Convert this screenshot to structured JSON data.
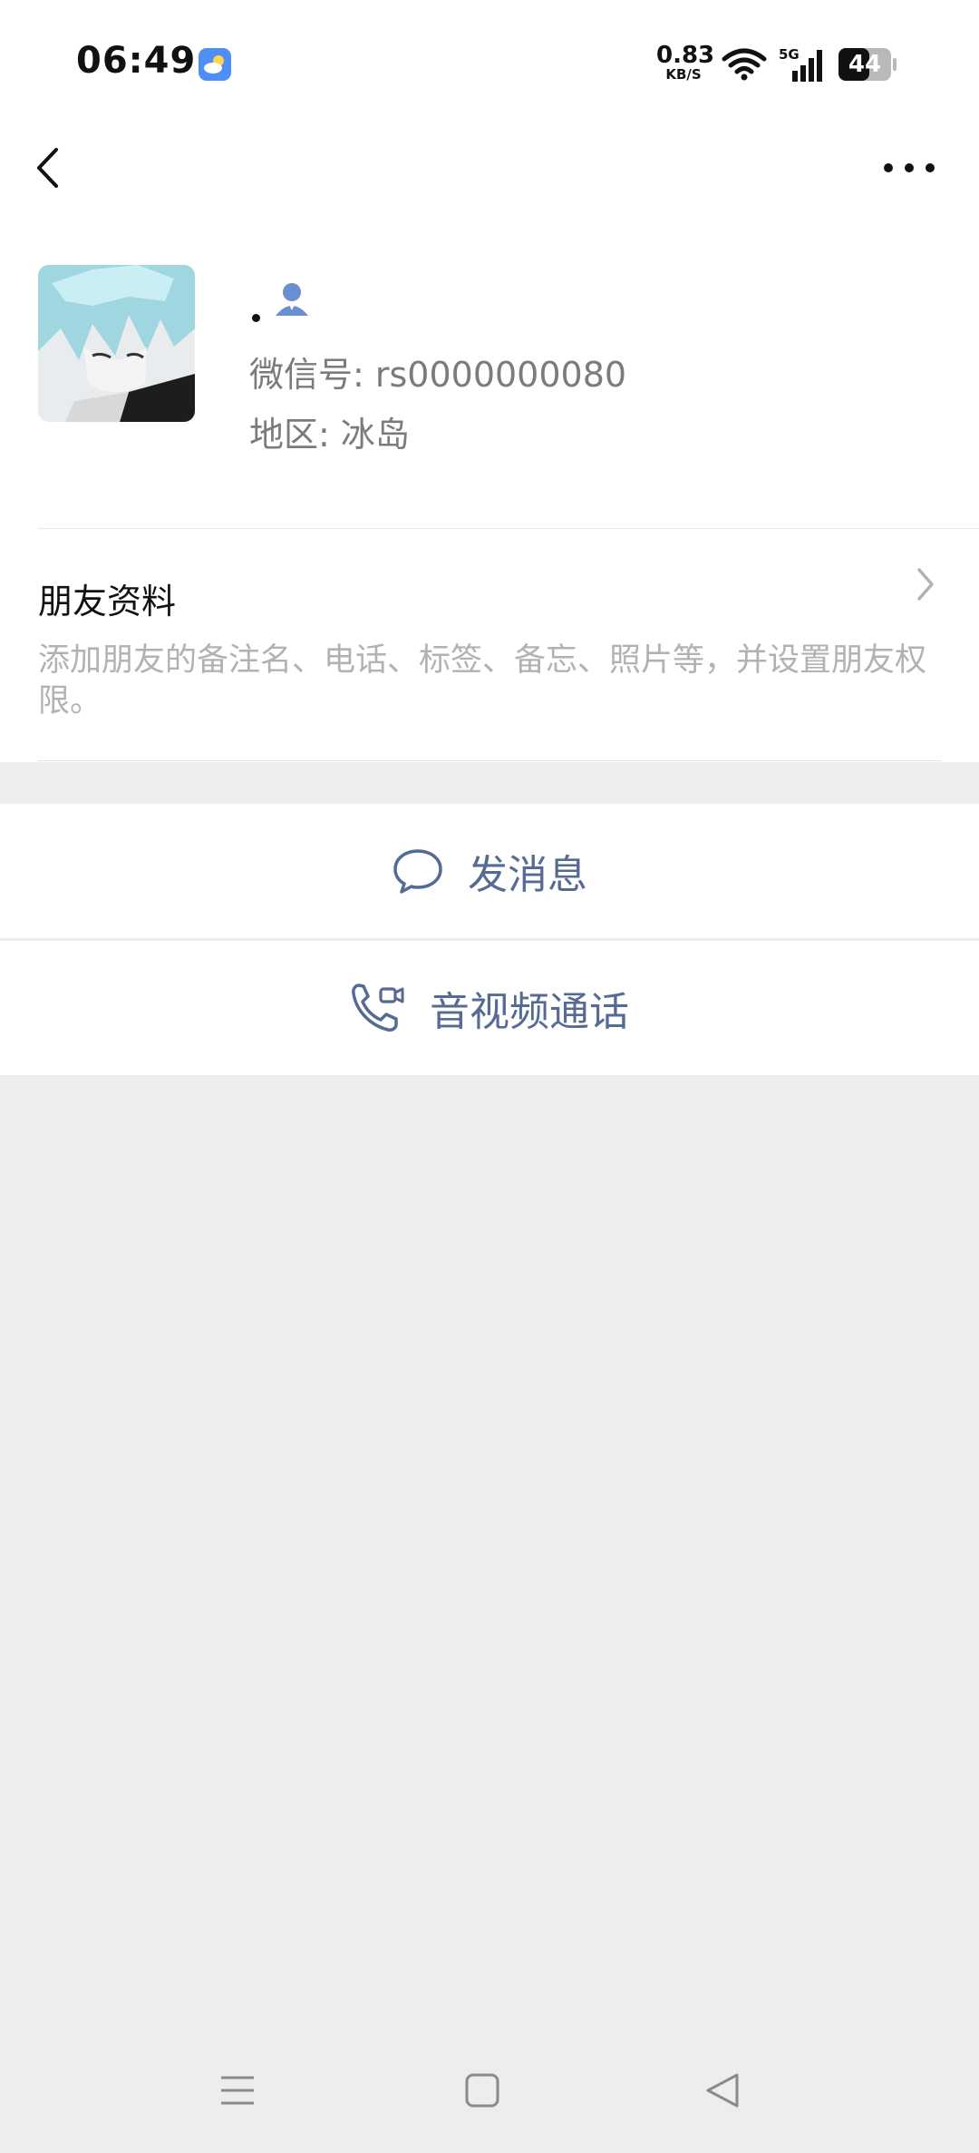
{
  "status_bar": {
    "time": "06:49",
    "net_speed_value": "0.83",
    "net_speed_unit": "KB/S",
    "signal_label": "5G",
    "battery_level": "44"
  },
  "header": {
    "back_icon": "chevron-left-icon",
    "more_icon": "more-horizontal-icon"
  },
  "profile": {
    "nickname": ".",
    "wechat_id": "微信号: rs0000000080",
    "region": "地区: 冰岛",
    "badge_icon": "contact-person-icon",
    "accent_color": "#6a8fd0"
  },
  "friend_info": {
    "title": "朋友资料",
    "description": "添加朋友的备注名、电话、标签、备忘、照片等，并设置朋友权限。"
  },
  "actions": {
    "send_message": "发消息",
    "video_call": "音视频通话",
    "label_color": "#566b94"
  },
  "nav_bar": {
    "menu_icon": "menu-icon",
    "home_icon": "home-square-icon",
    "back_icon": "back-triangle-icon"
  }
}
